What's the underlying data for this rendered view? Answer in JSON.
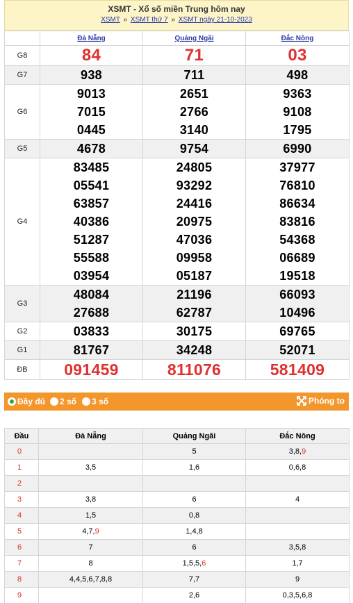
{
  "header": {
    "title": "XSMT - Xổ số miền Trung hôm nay",
    "crumbs": [
      "XSMT",
      "XSMT thứ 7",
      "XSMT ngày 21-10-2023"
    ],
    "separator": "»"
  },
  "provinces": [
    "Đà Nẵng",
    "Quảng Ngãi",
    "Đắc Nông"
  ],
  "prizes": [
    {
      "label": "G8",
      "values": [
        [
          "84"
        ],
        [
          "71"
        ],
        [
          "03"
        ]
      ]
    },
    {
      "label": "G7",
      "values": [
        [
          "938"
        ],
        [
          "711"
        ],
        [
          "498"
        ]
      ]
    },
    {
      "label": "G6",
      "values": [
        [
          "9013",
          "7015",
          "0445"
        ],
        [
          "2651",
          "2766",
          "3140"
        ],
        [
          "9363",
          "9108",
          "1795"
        ]
      ]
    },
    {
      "label": "G5",
      "values": [
        [
          "4678"
        ],
        [
          "9754"
        ],
        [
          "6990"
        ]
      ]
    },
    {
      "label": "G4",
      "values": [
        [
          "83485",
          "05541",
          "63857",
          "40386",
          "51287",
          "55588",
          "03954"
        ],
        [
          "24805",
          "93292",
          "24416",
          "20975",
          "47036",
          "09958",
          "05187"
        ],
        [
          "37977",
          "76810",
          "86634",
          "83816",
          "54368",
          "06689",
          "19518"
        ]
      ]
    },
    {
      "label": "G3",
      "values": [
        [
          "48084",
          "27688"
        ],
        [
          "21196",
          "62787"
        ],
        [
          "66093",
          "10496"
        ]
      ]
    },
    {
      "label": "G2",
      "values": [
        [
          "03833"
        ],
        [
          "30175"
        ],
        [
          "69765"
        ]
      ]
    },
    {
      "label": "G1",
      "values": [
        [
          "81767"
        ],
        [
          "34248"
        ],
        [
          "52071"
        ]
      ]
    },
    {
      "label": "ĐB",
      "values": [
        [
          "091459"
        ],
        [
          "811076"
        ],
        [
          "581409"
        ]
      ]
    }
  ],
  "options": {
    "full": "Đầy đủ",
    "two": "2 số",
    "three": "3 số",
    "zoom": "Phóng to",
    "selected": "full"
  },
  "dau_table": {
    "header": [
      "Đầu",
      "Đà Nẵng",
      "Quảng Ngãi",
      "Đắc Nông"
    ],
    "rows": [
      {
        "d": "0",
        "c": [
          [],
          [
            [
              "5",
              0
            ]
          ],
          [
            [
              "3,8,",
              0
            ],
            [
              "9",
              1
            ]
          ]
        ]
      },
      {
        "d": "1",
        "c": [
          [
            [
              "3,5",
              0
            ]
          ],
          [
            [
              "1,6",
              0
            ]
          ],
          [
            [
              "0,6,8",
              0
            ]
          ]
        ]
      },
      {
        "d": "2",
        "c": [
          [],
          [],
          []
        ]
      },
      {
        "d": "3",
        "c": [
          [
            [
              "3,8",
              0
            ]
          ],
          [
            [
              "6",
              0
            ]
          ],
          [
            [
              "4",
              0
            ]
          ]
        ]
      },
      {
        "d": "4",
        "c": [
          [
            [
              "1,5",
              0
            ]
          ],
          [
            [
              "0,8",
              0
            ]
          ],
          []
        ]
      },
      {
        "d": "5",
        "c": [
          [
            [
              "4,7,",
              0
            ],
            [
              "9",
              1
            ]
          ],
          [
            [
              "1,4,8",
              0
            ]
          ],
          []
        ]
      },
      {
        "d": "6",
        "c": [
          [
            [
              "7",
              0
            ]
          ],
          [
            [
              "6",
              0
            ]
          ],
          [
            [
              "3,5,8",
              0
            ]
          ]
        ]
      },
      {
        "d": "7",
        "c": [
          [
            [
              "8",
              0
            ]
          ],
          [
            [
              "1,5,5,",
              0
            ],
            [
              "6",
              1
            ]
          ],
          [
            [
              "1,7",
              0
            ]
          ]
        ]
      },
      {
        "d": "8",
        "c": [
          [
            [
              "4,4,5,6,7,8,8",
              0
            ]
          ],
          [
            [
              "7,7",
              0
            ]
          ],
          [
            [
              "9",
              0
            ]
          ]
        ]
      },
      {
        "d": "9",
        "c": [
          [],
          [
            [
              "2,6",
              0
            ]
          ],
          [
            [
              "0,3,5,6,8",
              0
            ]
          ]
        ]
      }
    ]
  },
  "colors": {
    "accent_red": "#e03030",
    "link_blue": "#2b3aa8",
    "bar_orange": "#f3962c",
    "header_bg": "#fdf4c8",
    "radio_green": "#2ea836"
  }
}
